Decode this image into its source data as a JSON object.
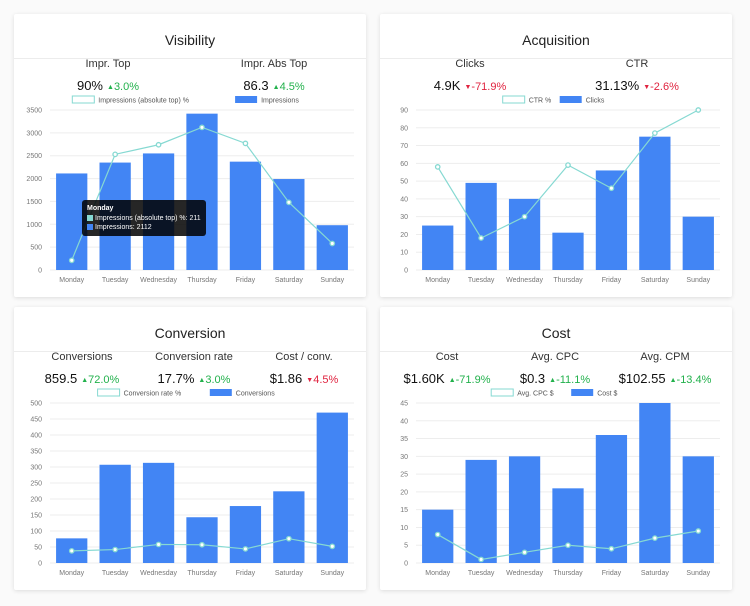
{
  "colors": {
    "bar": "#4285f4",
    "line": "#86d9d2",
    "up": "#22b14c",
    "down": "#e0233f"
  },
  "cards": [
    {
      "title": "Visibility",
      "kpis": [
        {
          "label": "Impr. Top",
          "value": "90%",
          "delta": "3.0%",
          "direction": "up"
        },
        {
          "label": "Impr. Abs Top",
          "value": "86.3",
          "delta": "4.5%",
          "direction": "up"
        }
      ],
      "tooltip": {
        "title": "Monday",
        "line_row": "Impressions (absolute top) %: 211",
        "bar_row": "Impressions: 2112"
      }
    },
    {
      "title": "Acquisition",
      "kpis": [
        {
          "label": "Clicks",
          "value": "4.9K",
          "delta": "-71.9%",
          "direction": "down"
        },
        {
          "label": "CTR",
          "value": "31.13%",
          "delta": "-2.6%",
          "direction": "down"
        }
      ]
    },
    {
      "title": "Conversion",
      "kpis": [
        {
          "label": "Conversions",
          "value": "859.5",
          "delta": "72.0%",
          "direction": "up"
        },
        {
          "label": "Conversion rate",
          "value": "17.7%",
          "delta": "3.0%",
          "direction": "up"
        },
        {
          "label": "Cost / conv.",
          "value": "$1.86",
          "delta": "4.5%",
          "direction": "down"
        }
      ]
    },
    {
      "title": "Cost",
      "kpis": [
        {
          "label": "Cost",
          "value": "$1.60K",
          "delta": "-71.9%",
          "direction": "up"
        },
        {
          "label": "Avg. CPC",
          "value": "$0.3",
          "delta": "-11.1%",
          "direction": "up"
        },
        {
          "label": "Avg. CPM",
          "value": "$102.55",
          "delta": "-13.4%",
          "direction": "up"
        }
      ]
    }
  ],
  "chart_data": [
    {
      "type": "bar",
      "categories": [
        "Monday",
        "Tuesday",
        "Wednesday",
        "Thursday",
        "Friday",
        "Saturday",
        "Sunday"
      ],
      "ylim": [
        0,
        3500
      ],
      "yticks": [
        0,
        500,
        1000,
        1500,
        2000,
        2500,
        3000,
        3500
      ],
      "series": [
        {
          "name": "Impressions (absolute top) %",
          "kind": "line",
          "values": [
            211,
            2530,
            2740,
            3120,
            2770,
            1480,
            580
          ]
        },
        {
          "name": "Impressions",
          "kind": "bar",
          "values": [
            2112,
            2350,
            2550,
            3420,
            2370,
            1990,
            980
          ]
        }
      ],
      "grid": true,
      "legend": "top"
    },
    {
      "type": "bar",
      "categories": [
        "Monday",
        "Tuesday",
        "Wednesday",
        "Thursday",
        "Friday",
        "Saturday",
        "Sunday"
      ],
      "ylim": [
        0,
        90
      ],
      "yticks": [
        0,
        10,
        20,
        30,
        40,
        50,
        60,
        70,
        80,
        90
      ],
      "series": [
        {
          "name": "CTR %",
          "kind": "line",
          "values": [
            58,
            18,
            30,
            59,
            46,
            77,
            90
          ]
        },
        {
          "name": "Clicks",
          "kind": "bar",
          "values": [
            25,
            49,
            40,
            21,
            56,
            75,
            30
          ]
        }
      ],
      "grid": true,
      "legend": "top"
    },
    {
      "type": "bar",
      "categories": [
        "Monday",
        "Tuesday",
        "Wednesday",
        "Thursday",
        "Friday",
        "Saturday",
        "Sunday"
      ],
      "ylim": [
        0,
        500
      ],
      "yticks": [
        0,
        50,
        100,
        150,
        200,
        250,
        300,
        350,
        400,
        450,
        500
      ],
      "series": [
        {
          "name": "Conversion rate %",
          "kind": "line",
          "values": [
            38,
            42,
            58,
            57,
            44,
            76,
            52
          ]
        },
        {
          "name": "Conversions",
          "kind": "bar",
          "values": [
            77,
            307,
            313,
            143,
            178,
            224,
            470
          ]
        }
      ],
      "grid": true,
      "legend": "top"
    },
    {
      "type": "bar",
      "categories": [
        "Monday",
        "Tuesday",
        "Wednesday",
        "Thursday",
        "Friday",
        "Saturday",
        "Sunday"
      ],
      "ylim": [
        0,
        45
      ],
      "yticks": [
        0,
        5,
        10,
        15,
        20,
        25,
        30,
        35,
        40,
        45
      ],
      "series": [
        {
          "name": "Avg. CPC $",
          "kind": "line",
          "values": [
            8,
            1,
            3,
            5,
            4,
            7,
            9
          ]
        },
        {
          "name": "Cost $",
          "kind": "bar",
          "values": [
            15,
            29,
            30,
            21,
            36,
            45,
            30
          ]
        }
      ],
      "grid": true,
      "legend": "top"
    }
  ]
}
